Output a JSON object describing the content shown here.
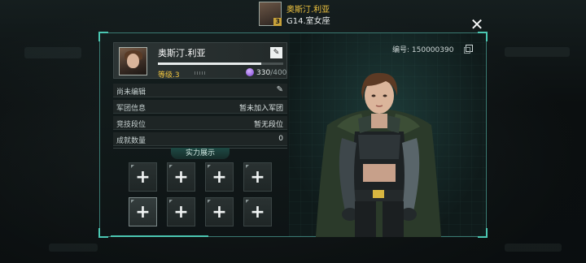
{
  "header": {
    "name": "奥斯汀.利亚",
    "subtitle": "G14.室女座",
    "avatar_level": "3"
  },
  "profile": {
    "name": "奥斯汀.利亚",
    "level_label": "等级.3",
    "xp_current": "330",
    "xp_max": "/400",
    "xp_fraction": 0.825,
    "uid": "编号: 150000390"
  },
  "rows": [
    {
      "key": "尚未编辑",
      "value": ""
    },
    {
      "key": "军团信息",
      "value": "暂未加入军团"
    },
    {
      "key": "竞技段位",
      "value": "暂无段位"
    },
    {
      "key": "成就数量",
      "value": "0"
    }
  ],
  "showcase": {
    "title": "实力展示"
  },
  "icons": {
    "close": "close-icon",
    "edit": "edit-icon",
    "pen": "pen-icon",
    "gem": "gem-icon",
    "copy": "copy-icon",
    "plus": "plus-icon"
  },
  "colors": {
    "accent": "#4bc7b2",
    "name_gold": "#f2c640",
    "gem_purple": "#7a3fd0"
  }
}
